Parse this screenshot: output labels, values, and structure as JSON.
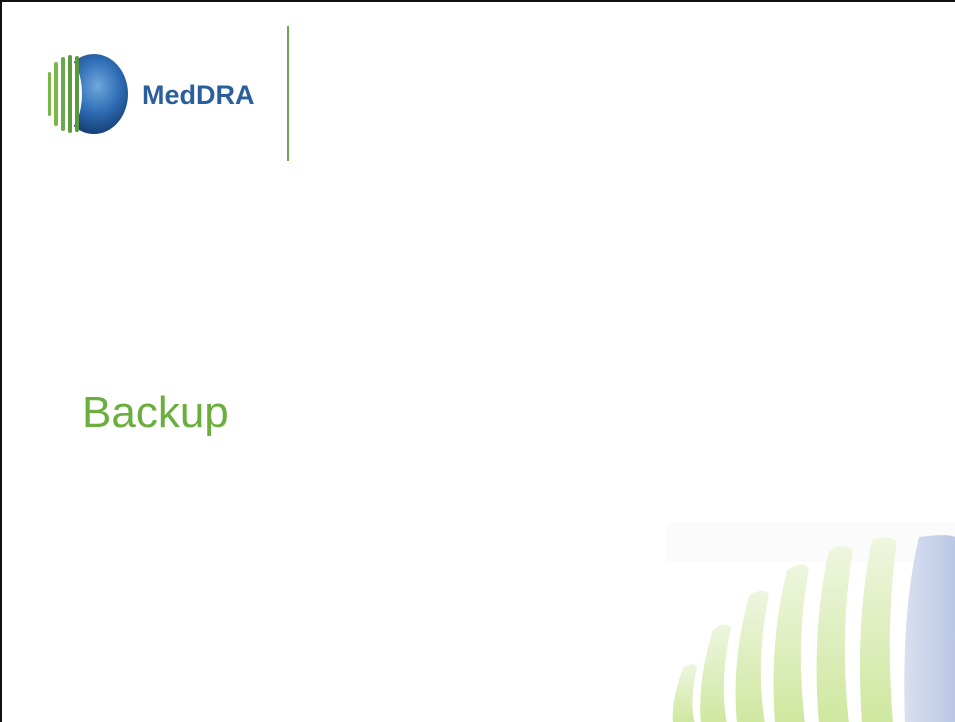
{
  "logo": {
    "text": "MedDRA",
    "icon": "meddra-globe-logo-icon",
    "text_color": "#2a5f9e",
    "green_color": "#6aa84f",
    "blue_color": "#1f5ea8"
  },
  "slide": {
    "title": "Backup",
    "title_color": "#6aaf3d"
  },
  "decoration": {
    "icon": "striped-globe-watermark-icon"
  }
}
